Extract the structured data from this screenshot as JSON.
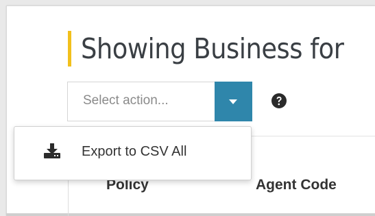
{
  "header": {
    "title": "Showing Business for"
  },
  "action_select": {
    "placeholder": "Select action...",
    "dropdown_icon": "caret-down-icon",
    "button_color": "#2f86ab"
  },
  "help": {
    "icon": "question-circle-icon"
  },
  "dropdown_menu": {
    "items": [
      {
        "label": "Export to CSV All",
        "icon": "download-icon"
      }
    ]
  },
  "table": {
    "columns": [
      "Policy",
      "Agent Code"
    ]
  },
  "colors": {
    "accent": "#f2c01c",
    "primary": "#2f86ab"
  }
}
